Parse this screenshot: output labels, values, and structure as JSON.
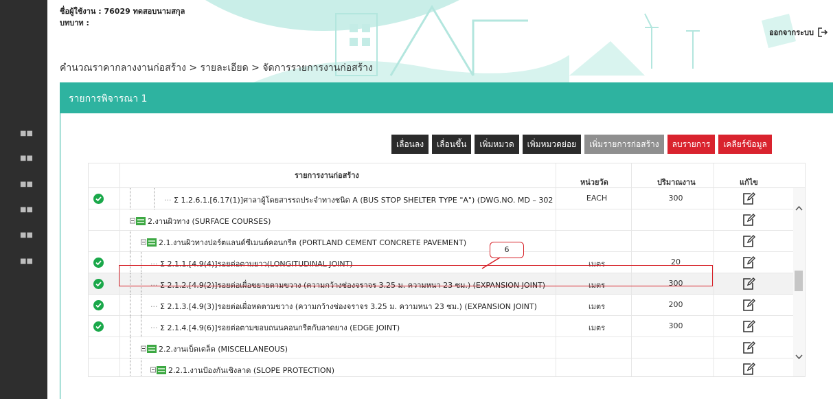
{
  "header": {
    "user_label": "ชื่อผู้ใช้งาน : 76029 ทดสอบนามสกุล",
    "role_label": "บทบาท :",
    "logout_label": "ออกจากระบบ"
  },
  "breadcrumb": "คำนวณราคากลางงานก่อสร้าง > รายละเอียด > จัดการรายการงานก่อสร้าง",
  "panel": {
    "title": "รายการพิจารณา 1"
  },
  "toolbar": {
    "move_down": "เลื่อนลง",
    "move_up": "เลื่อนขึ้น",
    "add_category": "เพิ่มหมวด",
    "add_subcategory": "เพิ่มหมวดย่อย",
    "add_item": "เพิ่มรายการก่อสร้าง",
    "delete_item": "ลบรายการ",
    "clear_data": "เคลียร์ข้อมูล"
  },
  "grid": {
    "columns": {
      "name": "รายการงานก่อสร้าง",
      "unit": "หน่วยวัด",
      "qty": "ปริมาณงาน",
      "edit": "แก้ไข"
    },
    "rows": [
      {
        "checked": true,
        "name": "Σ 1.2.6.1.[6.17(1)]ศาลาผู้โดยสารรถประจำทางชนิด A (BUS STOP SHELTER TYPE \"A\") (DWG.NO. MD – 302",
        "unit": "EACH",
        "qty": "300"
      },
      {
        "checked": false,
        "name": "2.งานผิวทาง (SURFACE COURSES)",
        "unit": "",
        "qty": ""
      },
      {
        "checked": false,
        "name": "2.1.งานผิวทางปอร์ตแลนด์ซีเมนต์คอนกรีต (PORTLAND CEMENT CONCRETE PAVEMENT)",
        "unit": "",
        "qty": ""
      },
      {
        "checked": true,
        "name": "Σ 2.1.1.[4.9(4)]รอยต่อตามยาว(LONGITUDINAL JOINT)",
        "unit": "เมตร",
        "qty": "20"
      },
      {
        "checked": true,
        "name": "Σ 2.1.2.[4.9(2)]รอยต่อเผื่อขยายตามขวาง (ความกว้างช่องจราจร 3.25 ม. ความหนา 23 ซม.) (EXPANSION JOINT)",
        "unit": "เมตร",
        "qty": "300"
      },
      {
        "checked": true,
        "name": "Σ 2.1.3.[4.9(3)]รอยต่อเผื่อหดตามขวาง (ความกว้างช่องจราจร 3.25 ม. ความหนา 23 ซม.) (EXPANSION JOINT)",
        "unit": "เมตร",
        "qty": "200"
      },
      {
        "checked": true,
        "name": "Σ 2.1.4.[4.9(6)]รอยต่อตามขอบถนนคอนกรีตกับลาดยาง (EDGE JOINT)",
        "unit": "เมตร",
        "qty": "300"
      },
      {
        "checked": false,
        "name": "2.2.งานเบ็ดเตล็ด (MISCELLANEOUS)",
        "unit": "",
        "qty": ""
      },
      {
        "checked": false,
        "name": "2.2.1.งานป้องกันเชิงลาด (SLOPE PROTECTION)",
        "unit": "",
        "qty": ""
      }
    ]
  },
  "callout": "6",
  "colors": {
    "teal": "#2eb3a0",
    "red": "#d9232e",
    "dark": "#2b2b2b",
    "check": "#1aa84a"
  }
}
